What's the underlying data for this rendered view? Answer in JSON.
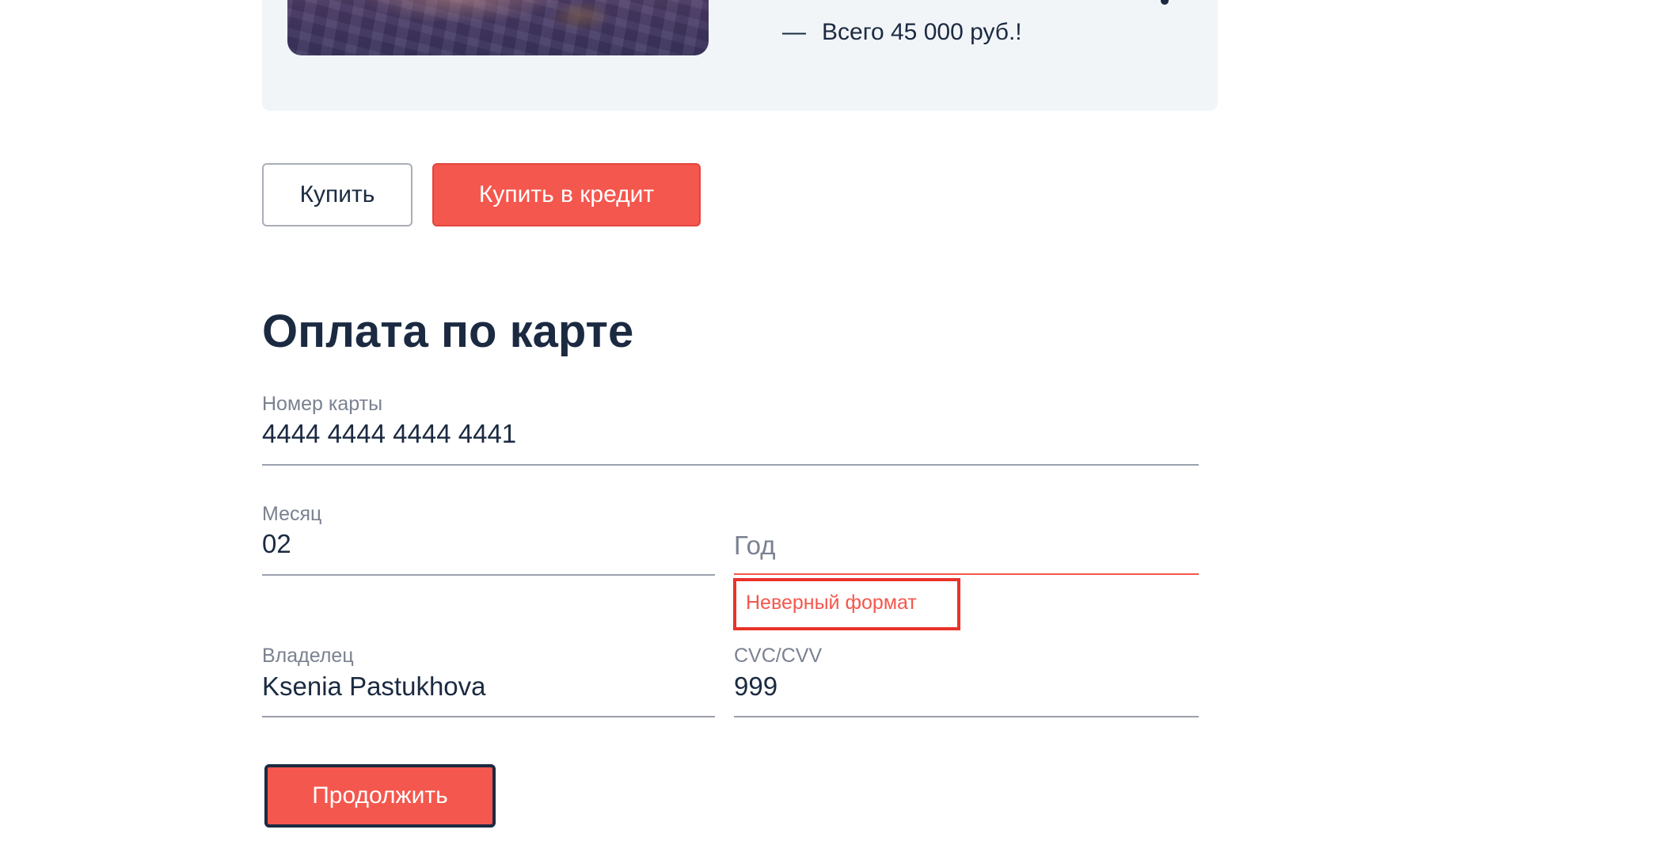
{
  "product": {
    "price_dash": "—",
    "price_text": "Всего 45 000 руб.!"
  },
  "buttons": {
    "buy": "Купить",
    "buy_credit": "Купить в кредит",
    "continue": "Продолжить"
  },
  "payment": {
    "title": "Оплата по карте",
    "card_number": {
      "label": "Номер карты",
      "value": "4444 4444 4444 4441"
    },
    "month": {
      "label": "Месяц",
      "value": "02"
    },
    "year": {
      "placeholder": "Год",
      "error": "Неверный формат"
    },
    "owner": {
      "label": "Владелец",
      "value": "Ksenia Pastukhova"
    },
    "cvc": {
      "label": "CVC/CVV",
      "value": "999"
    }
  },
  "colors": {
    "accent": "#f4574d",
    "error": "#e8332a",
    "text": "#1b2a41",
    "muted": "#7a8190",
    "card_bg": "#f2f5f8"
  }
}
